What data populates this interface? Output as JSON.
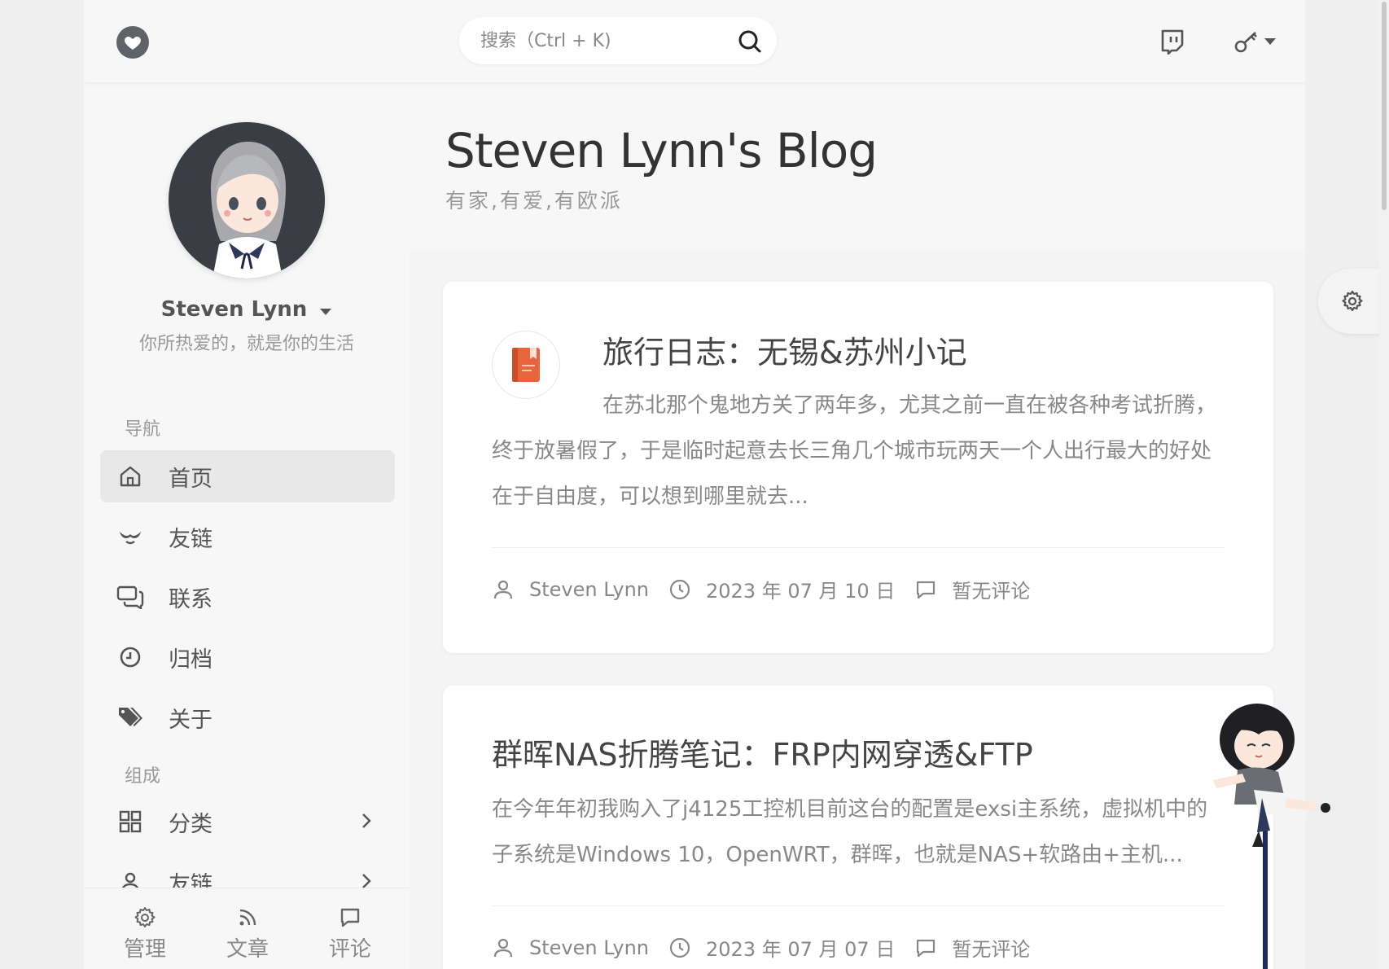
{
  "header": {
    "search_placeholder": "搜索（Ctrl + K)",
    "icons": [
      "heart-logo-icon",
      "search-icon",
      "twitch-icon",
      "key-icon",
      "caret-down-icon"
    ]
  },
  "sidebar": {
    "profile": {
      "name": "Steven Lynn",
      "motto": "你所热爱的，就是你的生活"
    },
    "nav_label": "导航",
    "nav_items": [
      {
        "label": "首页",
        "icon": "home-icon",
        "active": true
      },
      {
        "label": "友链",
        "icon": "mustache-icon"
      },
      {
        "label": "联系",
        "icon": "chat-icon"
      },
      {
        "label": "归档",
        "icon": "clock-icon"
      },
      {
        "label": "关于",
        "icon": "tags-icon"
      }
    ],
    "group_label": "组成",
    "group_items": [
      {
        "label": "分类",
        "icon": "grid-icon"
      },
      {
        "label": "友链",
        "icon": "user-icon"
      }
    ],
    "bottom_bar": [
      {
        "label": "管理",
        "icon": "gear-icon"
      },
      {
        "label": "文章",
        "icon": "rss-icon"
      },
      {
        "label": "评论",
        "icon": "comment-icon"
      }
    ]
  },
  "banner": {
    "title": "Steven Lynn's Blog",
    "subtitle": "有家,有爱,有欧派"
  },
  "posts": [
    {
      "title": "旅行日志：无锡&苏州小记",
      "excerpt": "在苏北那个鬼地方关了两年多，尤其之前一直在被各种考试折腾，终于放暑假了，于是临时起意去长三角几个城市玩两天一个人出行最大的好处在于自由度，可以想到哪里就去...",
      "author": "Steven Lynn",
      "date": "2023 年 07 月 10 日",
      "comments": "暂无评论",
      "icon": "book-icon"
    },
    {
      "title": "群晖NAS折腾笔记：FRP内网穿透&FTP",
      "excerpt": "在今年年初我购入了j4125工控机目前这台的配置是exsi主系统，虚拟机中的子系统是Windows 10，OpenWRT，群晖，也就是NAS+软路由+主机...",
      "author": "Steven Lynn",
      "date": "2023 年 07 月 07 日",
      "comments": "暂无评论"
    }
  ],
  "colors": {
    "accent": "#e8e8e8",
    "book": "#e8643c",
    "text": "#333333",
    "muted": "#888888"
  }
}
